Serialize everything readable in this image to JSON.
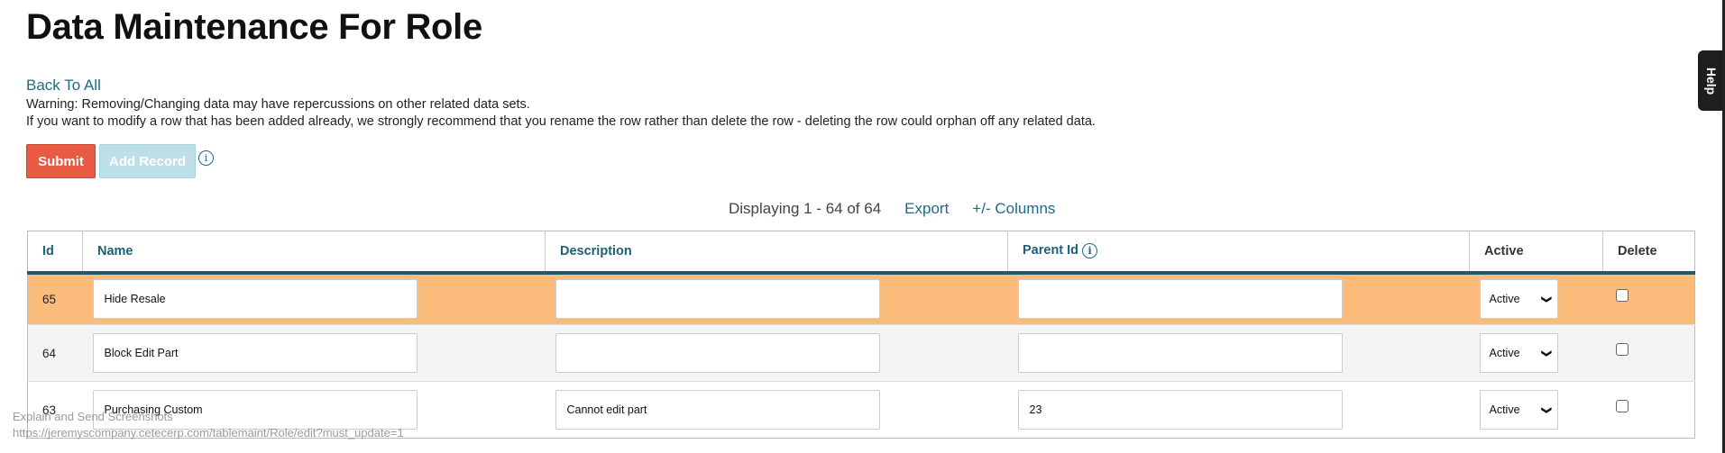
{
  "page": {
    "title": "Data Maintenance For Role",
    "back_link": "Back To All",
    "warning1": "Warning: Removing/Changing data may have repercussions on other related data sets.",
    "warning2": "If you want to modify a row that has been added already, we strongly recommend that you rename the row rather than delete the row - deleting the row could orphan off any related data."
  },
  "toolbar": {
    "submit": "Submit",
    "add_record": "Add Record",
    "info_icon": "i"
  },
  "listing": {
    "displaying": "Displaying 1 - 64 of 64",
    "export": "Export",
    "columns": "+/- Columns"
  },
  "table": {
    "headers": [
      "Id",
      "Name",
      "Description",
      "Parent Id",
      "Active",
      "Delete"
    ],
    "rows": [
      {
        "id": "65",
        "name": "Hide Resale",
        "description": "",
        "parent_id": "",
        "active": "Active",
        "delete": false
      },
      {
        "id": "64",
        "name": "Block Edit Part",
        "description": "",
        "parent_id": "",
        "active": "Active",
        "delete": false
      },
      {
        "id": "63",
        "name": "Purchasing Custom",
        "description": "Cannot edit part",
        "parent_id": "23",
        "active": "Active",
        "delete": false
      }
    ]
  },
  "help": {
    "label": "Help"
  },
  "overlay": {
    "line1": "Explain and Send Screenshots",
    "line2": "https://jeremyscompany.cetecerp.com/tablemaint/Role/edit?must_update=1"
  },
  "colors": {
    "submit": "#e85a43",
    "add_record": "#bde0e8",
    "highlight_row": "#fbbb7b",
    "link": "#1f6a86",
    "header_border": "#225a6b"
  }
}
